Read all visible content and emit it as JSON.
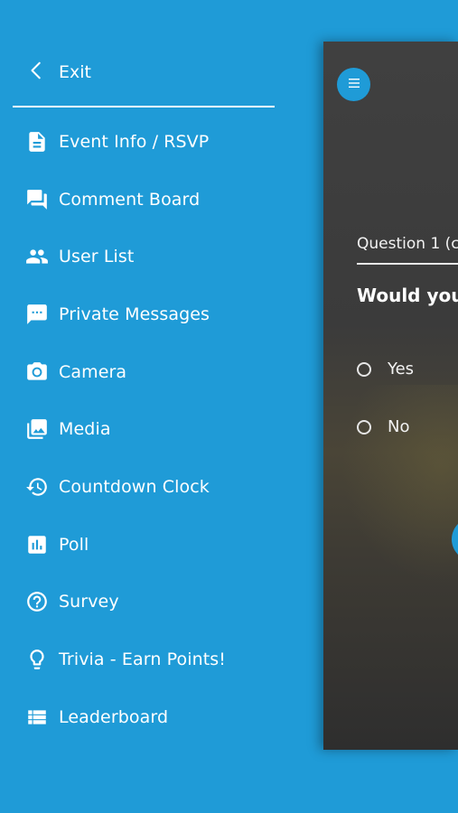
{
  "sidebar": {
    "exit_label": "Exit",
    "items": [
      {
        "label": "Event Info / RSVP",
        "icon": "document-icon"
      },
      {
        "label": "Comment Board",
        "icon": "chat-icon"
      },
      {
        "label": "User List",
        "icon": "users-icon"
      },
      {
        "label": "Private Messages",
        "icon": "message-icon"
      },
      {
        "label": "Camera",
        "icon": "camera-icon"
      },
      {
        "label": "Media",
        "icon": "image-gallery-icon"
      },
      {
        "label": "Countdown Clock",
        "icon": "history-clock-icon"
      },
      {
        "label": "Poll",
        "icon": "bar-chart-icon"
      },
      {
        "label": "Survey",
        "icon": "question-circle-icon"
      },
      {
        "label": "Trivia - Earn Points!",
        "icon": "lightbulb-icon"
      },
      {
        "label": "Leaderboard",
        "icon": "list-icon"
      }
    ]
  },
  "panel": {
    "question_label": "Question 1 (c",
    "question_text": "Would you representa",
    "options": [
      "Yes",
      "No"
    ]
  },
  "colors": {
    "accent": "#1f9bd7",
    "panel_dark": "#404040"
  }
}
